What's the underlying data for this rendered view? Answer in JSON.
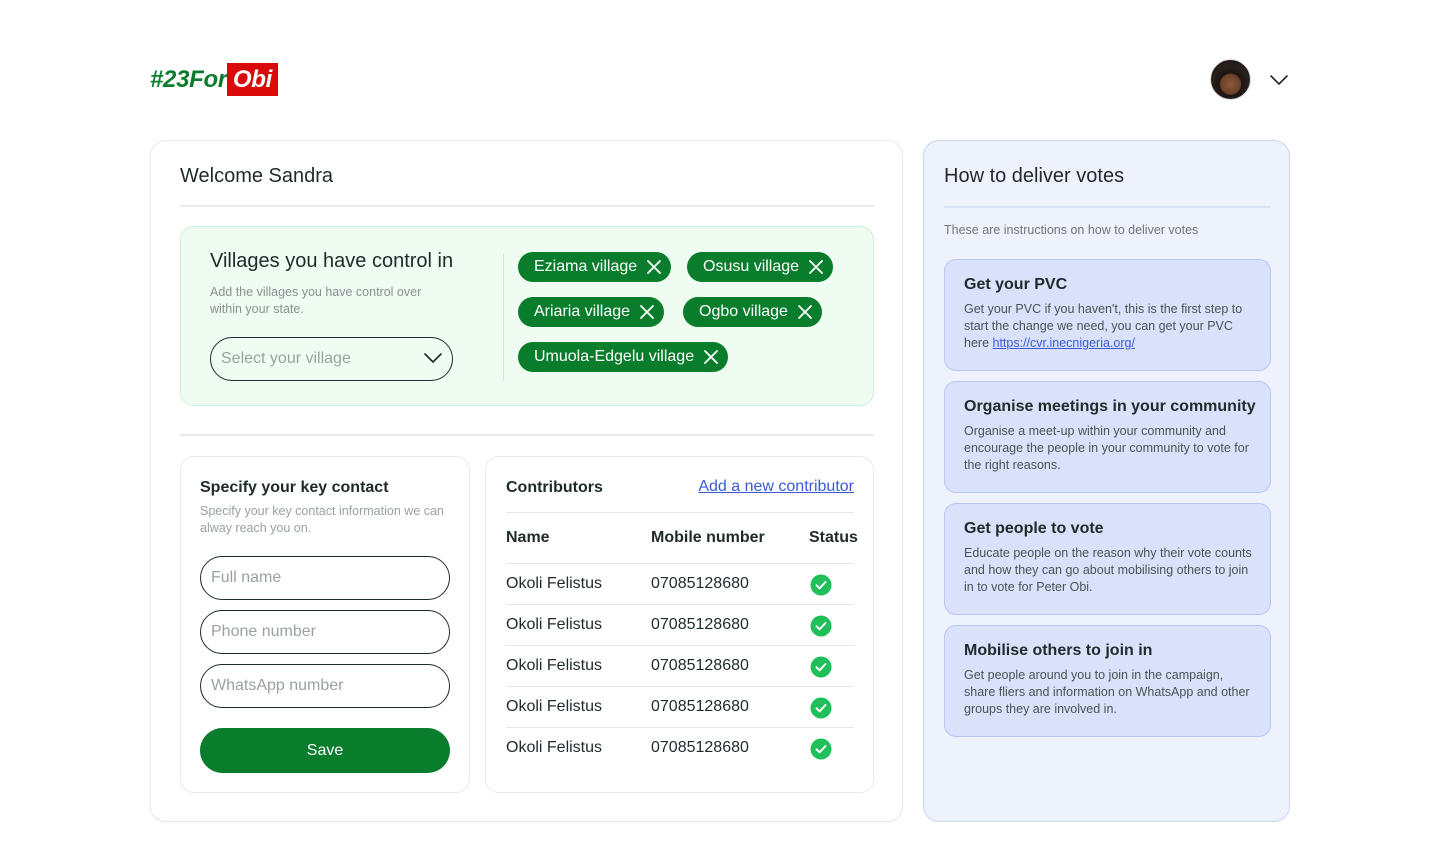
{
  "logo": {
    "part1": "#23For",
    "part2": "Obi"
  },
  "welcome": "Welcome Sandra",
  "villages": {
    "title": "Villages you have control in",
    "description": "Add the villages you have control over within your state.",
    "select_placeholder": "Select your village",
    "chips": [
      "Eziama village",
      "Osusu village",
      "Ariaria village",
      "Ogbo village",
      "Umuola-Edgelu village"
    ]
  },
  "contact": {
    "title": "Specify your key contact",
    "description": "Specify your key contact information we can alway reach you on.",
    "full_name_placeholder": "Full name",
    "phone_placeholder": "Phone number",
    "whatsapp_placeholder": "WhatsApp number",
    "save_label": "Save"
  },
  "contributors": {
    "title": "Contributors",
    "add_link": "Add a new contributor",
    "headers": {
      "name": "Name",
      "mobile": "Mobile number",
      "status": "Status"
    },
    "rows": [
      {
        "name": "Okoli Felistus",
        "mobile": "07085128680",
        "status": "check-circle-icon"
      },
      {
        "name": "Okoli Felistus",
        "mobile": "07085128680",
        "status": "check-circle-icon"
      },
      {
        "name": "Okoli Felistus",
        "mobile": "07085128680",
        "status": "check-circle-icon"
      },
      {
        "name": "Okoli Felistus",
        "mobile": "07085128680",
        "status": "check-circle-icon"
      },
      {
        "name": "Okoli Felistus",
        "mobile": "07085128680",
        "status": "check-circle-icon"
      }
    ]
  },
  "sidebar": {
    "title": "How to deliver votes",
    "intro": "These are instructions on how to deliver votes",
    "tips": [
      {
        "title": "Get your PVC",
        "body": "Get your PVC if you haven't, this is the first step to start the change we need, you can get your PVC here ",
        "link": "https://cvr.inecnigeria.org/"
      },
      {
        "title": "Organise meetings in your community",
        "body": "Organise a meet-up within your community and encourage the people in your community to vote for the right reasons."
      },
      {
        "title": "Get people to vote",
        "body": "Educate people on the reason why their vote counts and how they can go about mobilising others to join in to vote for Peter Obi."
      },
      {
        "title": "Mobilise others to join in",
        "body": "Get people around you to join in the campaign, share fliers and information on WhatsApp and other groups they are involved in."
      }
    ]
  },
  "colors": {
    "brand_green": "#0a7d2c",
    "brand_red": "#d90a0a",
    "link_blue": "#3a5ad9"
  }
}
